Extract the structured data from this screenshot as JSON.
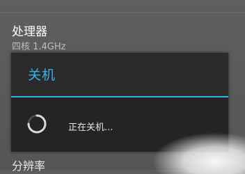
{
  "settings": {
    "processor": {
      "title": "处理器",
      "value": "四核 1.4GHz"
    },
    "resolution": {
      "title": "分辨率"
    }
  },
  "dialog": {
    "title": "关机",
    "message": "正在关机...",
    "accent_color": "#33b5e5"
  }
}
